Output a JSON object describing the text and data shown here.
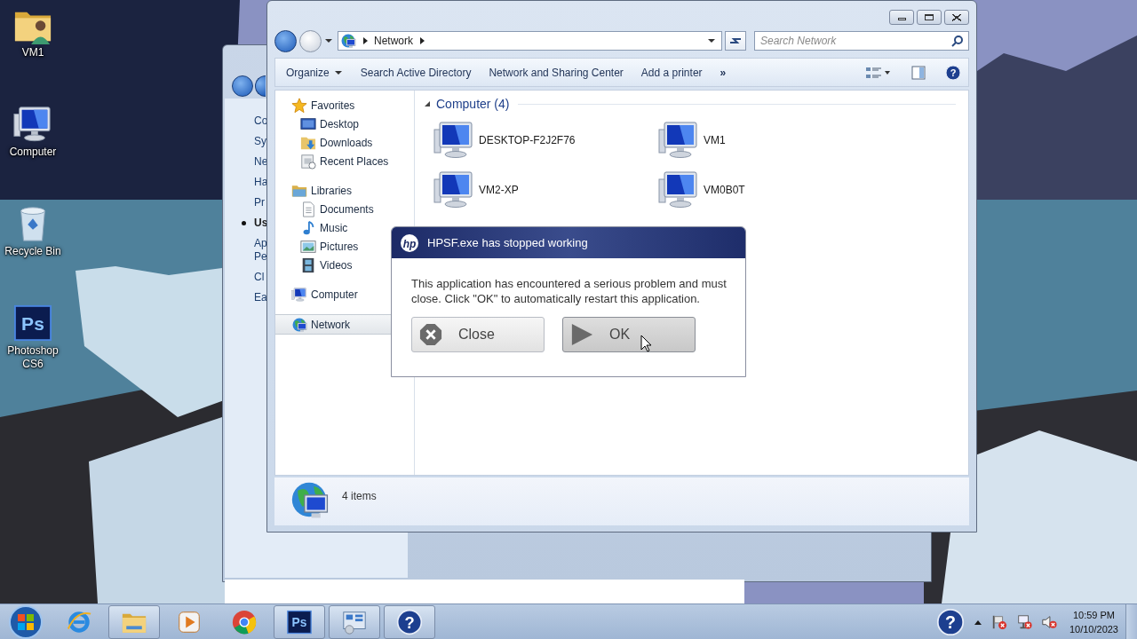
{
  "desktop_icons": [
    {
      "label": "VM1",
      "kind": "user-folder"
    },
    {
      "label": "Computer",
      "kind": "computer"
    },
    {
      "label": "Recycle Bin",
      "kind": "recycle-bin"
    },
    {
      "label": "Photoshop CS6",
      "kind": "photoshop",
      "glyph": "Ps"
    }
  ],
  "back_window": {
    "items": [
      {
        "lines": [
          "Co"
        ],
        "selected": false
      },
      {
        "lines": [
          "Sy"
        ],
        "selected": false
      },
      {
        "lines": [
          "Ne"
        ],
        "selected": false
      },
      {
        "lines": [
          "Ha"
        ],
        "selected": false
      },
      {
        "lines": [
          "Pr"
        ],
        "selected": false
      },
      {
        "lines": [
          "Us"
        ],
        "selected": true
      },
      {
        "lines": [
          "Ap",
          "Pe"
        ],
        "selected": false
      },
      {
        "lines": [
          "Cl"
        ],
        "selected": false
      },
      {
        "lines": [
          "Ea"
        ],
        "selected": false
      }
    ]
  },
  "explorer": {
    "address": [
      "Network"
    ],
    "search": {
      "placeholder": "Search Network"
    },
    "commands": [
      {
        "label": "Organize",
        "kind": "menu"
      },
      {
        "label": "Search Active Directory",
        "kind": "plain"
      },
      {
        "label": "Network and Sharing Center",
        "kind": "plain"
      },
      {
        "label": "Add a printer",
        "kind": "plain"
      },
      {
        "label": "»",
        "kind": "more"
      }
    ],
    "tools": [
      {
        "kind": "views"
      },
      {
        "kind": "preview-pane"
      },
      {
        "kind": "help",
        "glyph": "?"
      }
    ],
    "nav": [
      {
        "label": "Favorites",
        "kind": "star",
        "selected": false,
        "children": [
          {
            "label": "Desktop",
            "kind": "desktop",
            "selected": false
          },
          {
            "label": "Downloads",
            "kind": "downloads",
            "selected": false
          },
          {
            "label": "Recent Places",
            "kind": "recent",
            "selected": false
          }
        ]
      },
      {
        "label": "Libraries",
        "kind": "library",
        "selected": false,
        "children": [
          {
            "label": "Documents",
            "kind": "documents",
            "selected": false
          },
          {
            "label": "Music",
            "kind": "music",
            "selected": false
          },
          {
            "label": "Pictures",
            "kind": "pictures",
            "selected": false
          },
          {
            "label": "Videos",
            "kind": "videos",
            "selected": false
          }
        ]
      },
      {
        "label": "Computer",
        "kind": "computer",
        "selected": false
      },
      {
        "label": "Network",
        "kind": "network",
        "selected": true
      }
    ],
    "group": {
      "title": "Computer (4)",
      "expanded": true
    },
    "items": [
      {
        "label": "DESKTOP-F2J2F76",
        "kind": "computer"
      },
      {
        "label": "VM1",
        "kind": "computer"
      },
      {
        "label": "VM2-XP",
        "kind": "computer"
      },
      {
        "label": "VM0B0T",
        "kind": "computer"
      }
    ],
    "status": "4 items"
  },
  "dialog": {
    "logo": "hp",
    "title": "HPSF.exe has stopped working",
    "message": "This application has encountered a serious problem and must close. Click \"OK\" to automatically restart this application.",
    "buttons": [
      {
        "label": "Close",
        "kind": "close",
        "pressed": false
      },
      {
        "label": "OK",
        "kind": "play",
        "pressed": true
      }
    ]
  },
  "taskbar": {
    "apps": [
      {
        "kind": "ie",
        "running": false
      },
      {
        "kind": "folder",
        "running": true
      },
      {
        "kind": "media",
        "running": false
      },
      {
        "kind": "chrome",
        "running": false
      },
      {
        "kind": "photoshop",
        "glyph": "Ps",
        "running": true
      },
      {
        "kind": "control-panel",
        "running": true
      },
      {
        "kind": "help",
        "glyph": "?",
        "running": true
      }
    ],
    "tray": [
      {
        "kind": "help",
        "glyph": "?"
      },
      {
        "kind": "up-arrow"
      },
      {
        "kind": "flag"
      },
      {
        "kind": "network-tray"
      },
      {
        "kind": "speaker"
      }
    ],
    "clock": {
      "time": "10:59 PM",
      "date": "10/10/2023"
    }
  }
}
